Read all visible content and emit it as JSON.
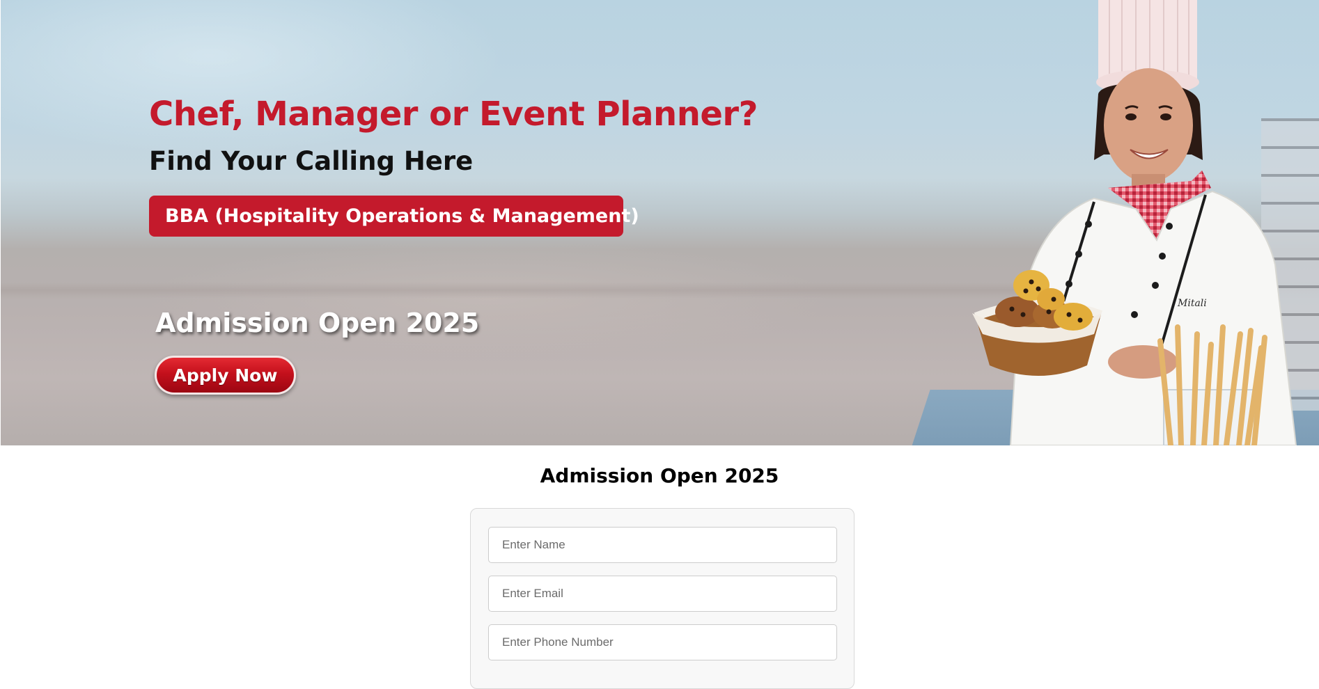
{
  "hero": {
    "headline": "Chef, Manager or Event Planner?",
    "subheadline": "Find Your Calling Here",
    "program": "BBA (Hospitality Operations & Management)",
    "admission": "Admission Open 2025",
    "apply_label": "Apply Now"
  },
  "form": {
    "title": "Admission Open 2025",
    "name_placeholder": "Enter Name",
    "email_placeholder": "Enter Email",
    "phone_placeholder": "Enter Phone Number"
  },
  "colors": {
    "brand_red": "#c41a2c",
    "sky": "#bcd4e2",
    "card_bg": "#f8f8f8"
  },
  "icons": [
    "chef-photo"
  ]
}
